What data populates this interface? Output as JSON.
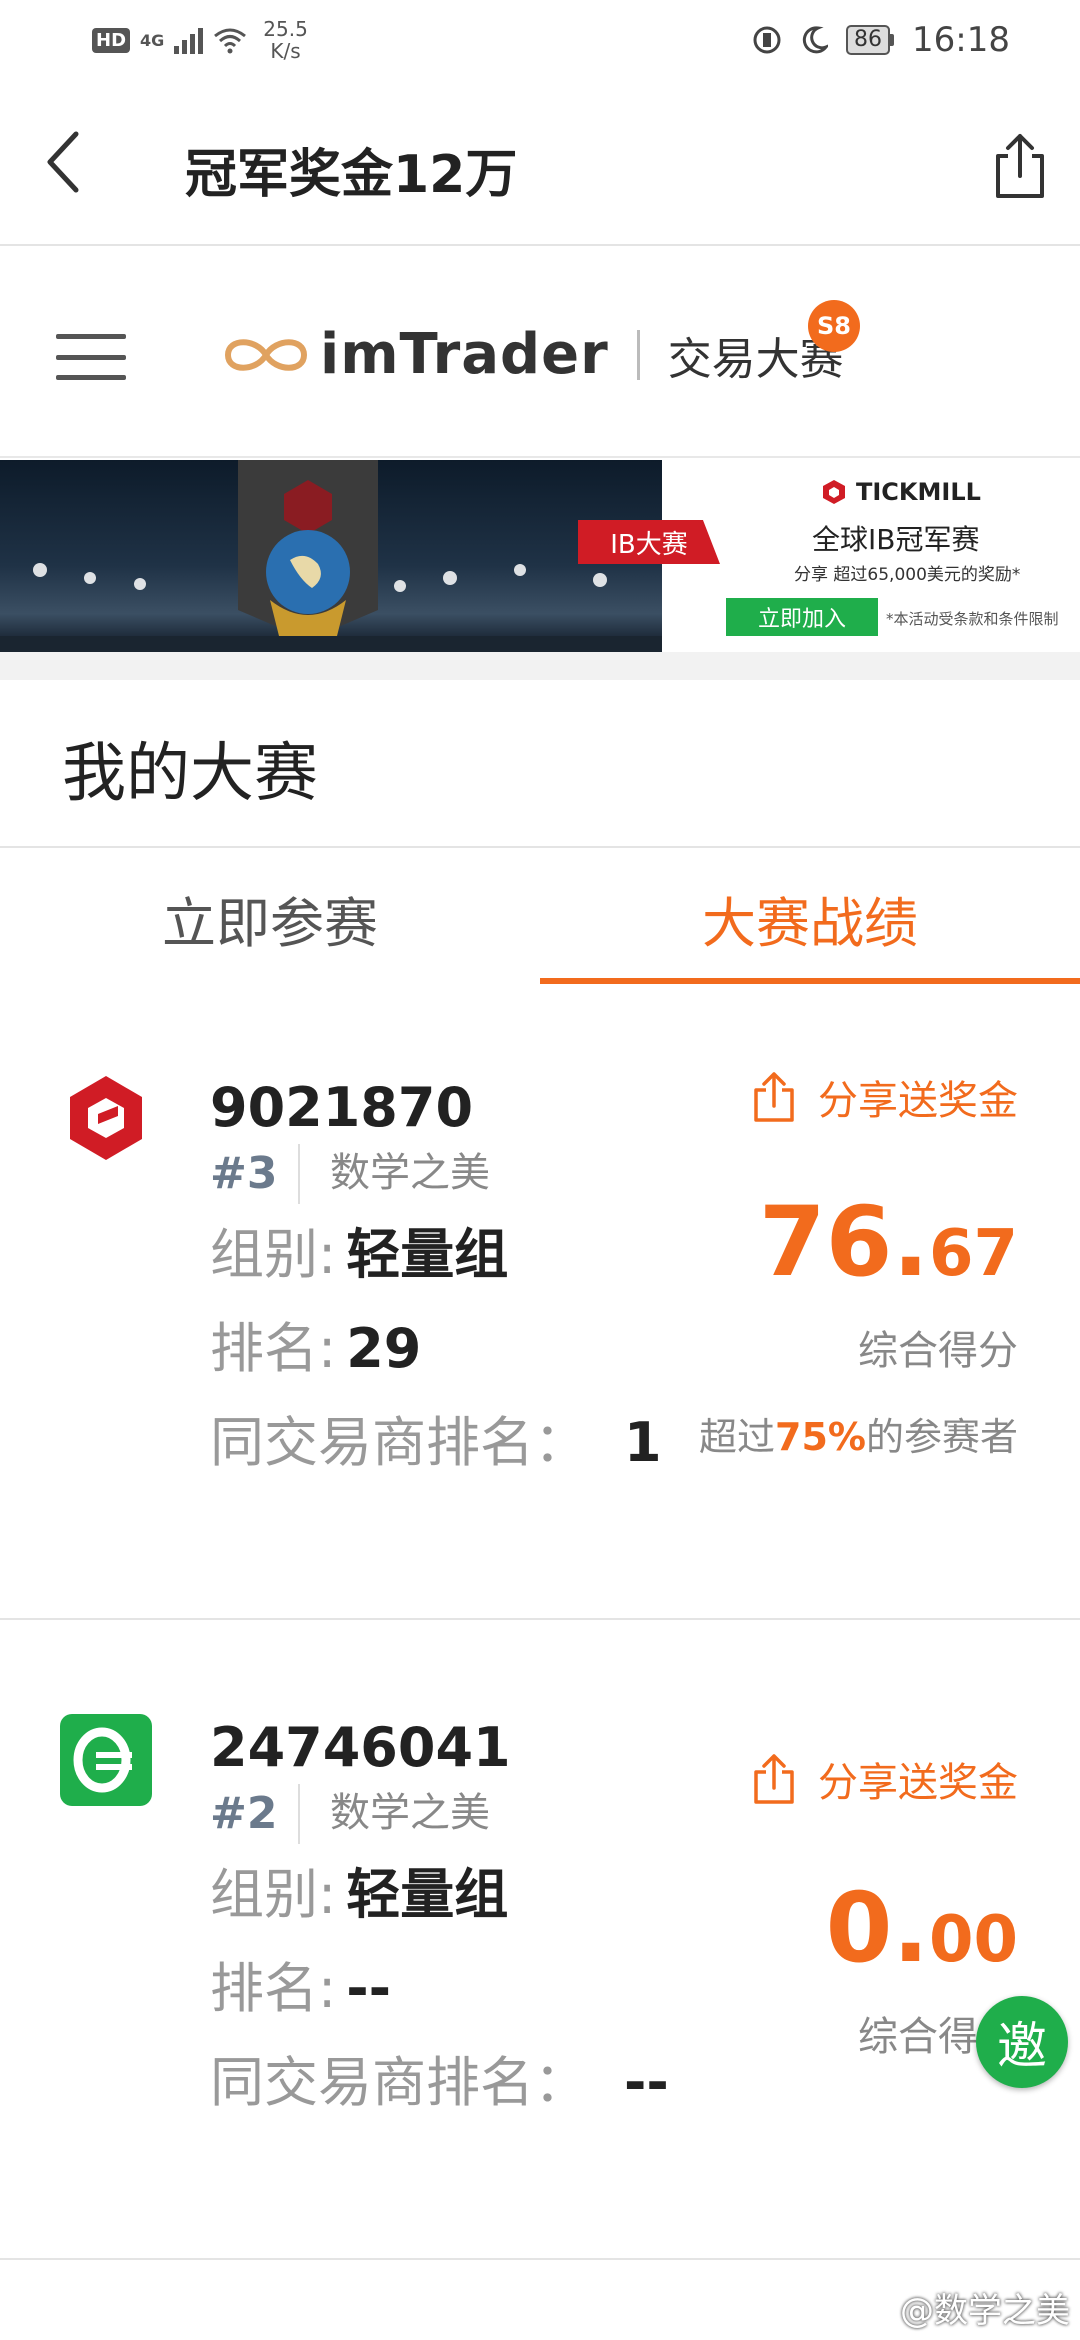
{
  "status_bar": {
    "hd": "HD",
    "network": "4G",
    "speed_value": "25.5",
    "speed_unit": "K/s",
    "battery": "86",
    "time": "16:18"
  },
  "nav": {
    "title": "冠军奖金12万",
    "back_icon": "chevron-left-icon",
    "share_icon": "share-icon"
  },
  "brand": {
    "logo_text": "imTrader",
    "subtitle": "交易大赛",
    "season": "S8"
  },
  "banner": {
    "tag": "IB大赛",
    "broker": "TICKMILL",
    "headline": "全球IB冠军赛",
    "subline": "分享 超过65,000美元的奖励*",
    "cta": "立即加入",
    "note": "*本活动受条款和条件限制"
  },
  "section": {
    "title": "我的大赛"
  },
  "tabs": [
    {
      "label": "立即参赛",
      "active": false
    },
    {
      "label": "大赛战绩",
      "active": true
    }
  ],
  "accounts": [
    {
      "account_no": "9021870",
      "rank_badge": "#3",
      "user": "数学之美",
      "group_label": "组别:",
      "group": "轻量组",
      "ranking_label": "排名:",
      "ranking": "29",
      "broker_rank_label": "同交易商排名：",
      "broker_rank": "1",
      "share": "分享送奖金",
      "score_int": "76.",
      "score_dec": "67",
      "score_label": "综合得分",
      "beat_prefix": "超过",
      "beat_percent": "75%",
      "beat_suffix": "的参赛者",
      "logo_color": "#d01c25"
    },
    {
      "account_no": "24746041",
      "rank_badge": "#2",
      "user": "数学之美",
      "group_label": "组别:",
      "group": "轻量组",
      "ranking_label": "排名:",
      "ranking": "--",
      "broker_rank_label": "同交易商排名：",
      "broker_rank": "--",
      "share": "分享送奖金",
      "score_int": "0.",
      "score_dec": "00",
      "score_label": "综合得分",
      "logo_color": "#1fae4b"
    }
  ],
  "invite": {
    "label": "邀"
  },
  "watermark": "@数学之美",
  "colors": {
    "accent": "#f26b1d",
    "green": "#1fae4b",
    "red": "#d01c25"
  }
}
